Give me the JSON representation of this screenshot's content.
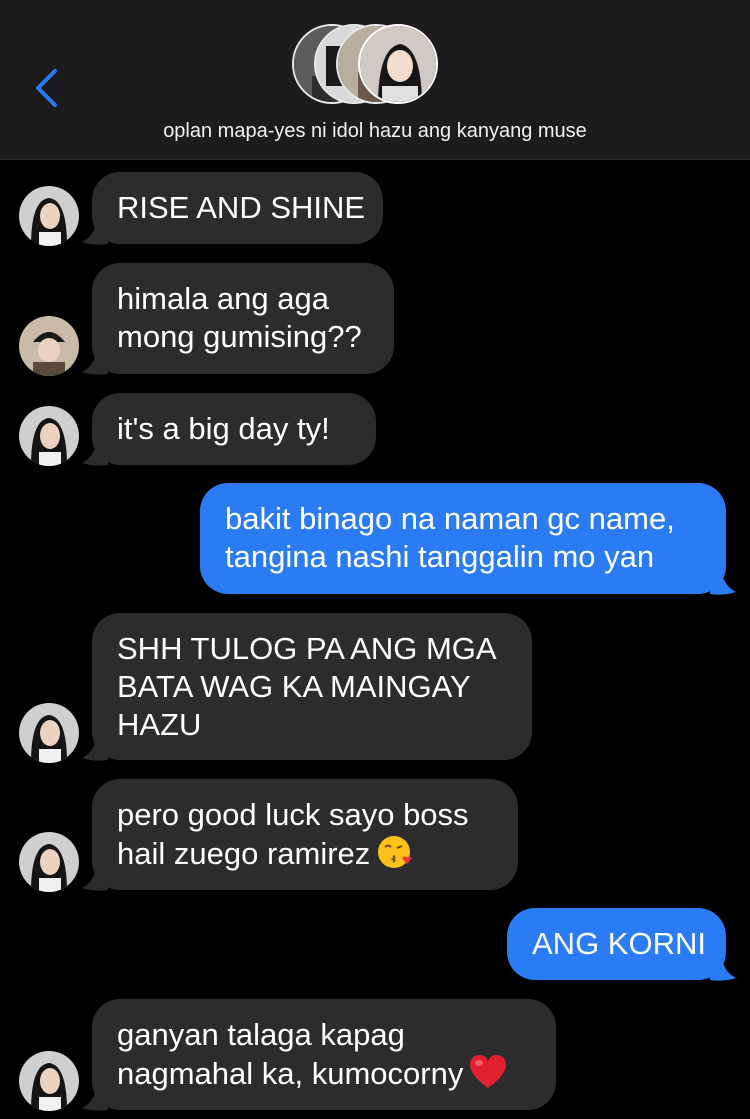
{
  "header": {
    "group_name": "oplan mapa-yes ni idol hazu ang kanyang muse",
    "back_icon": "chevron-left-icon",
    "accent": "#2b7cf4"
  },
  "colors": {
    "incoming_bubble": "#2c2c2e",
    "outgoing_bubble": "#2b7cf4",
    "background": "#000000"
  },
  "messages": [
    {
      "direction": "in",
      "text": "RISE AND SHINE"
    },
    {
      "direction": "in",
      "text": "himala ang aga\nmong gumising??"
    },
    {
      "direction": "in",
      "text": "it's a big day ty!"
    },
    {
      "direction": "out",
      "text": "bakit binago na naman gc name,\ntangina nashi tanggalin mo yan"
    },
    {
      "direction": "in",
      "text": "SHH TULOG PA ANG MGA\nBATA WAG KA MAINGAY\nHAZU"
    },
    {
      "direction": "in",
      "text": "pero good luck sayo boss\nhail zuego ramirez",
      "emoji": "face-blowing-kiss"
    },
    {
      "direction": "out",
      "text": "ANG KORNI"
    },
    {
      "direction": "in",
      "text": "ganyan talaga kapag\nnagmahal ka, kumocorny",
      "emoji": "red-heart"
    }
  ]
}
